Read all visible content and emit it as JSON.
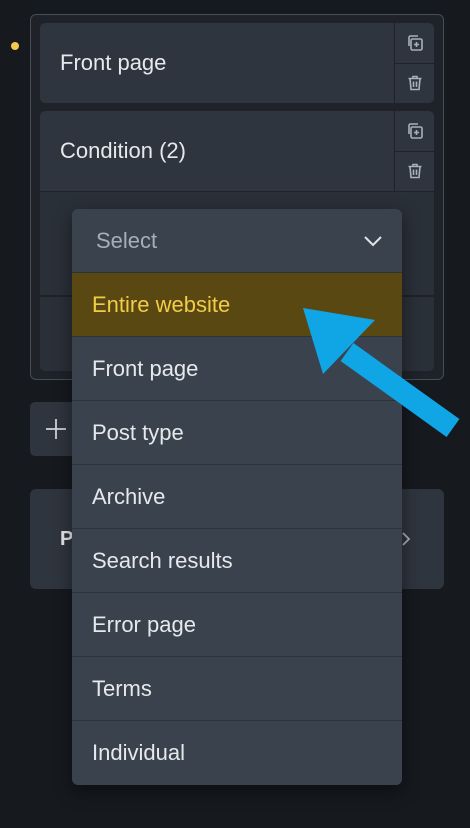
{
  "conditions": {
    "rows": [
      {
        "label": "Front page"
      },
      {
        "label": "Condition (2)"
      }
    ]
  },
  "dropdown": {
    "placeholder": "Select",
    "options": [
      "Entire website",
      "Front page",
      "Post type",
      "Archive",
      "Search results",
      "Error page",
      "Terms",
      "Individual"
    ],
    "highlighted_index": 0
  },
  "card": {
    "letter": "P"
  },
  "colors": {
    "accent": "#f2c94c",
    "highlight_bg": "#5a4813",
    "arrow": "#10a6e6"
  }
}
